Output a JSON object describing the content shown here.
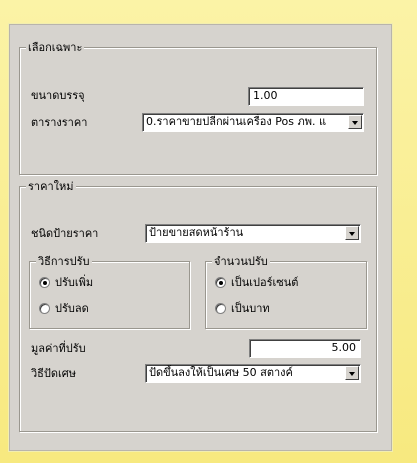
{
  "group_select": {
    "title": "เลือกเฉพาะ",
    "package_size": {
      "label": "ขนาดบรรจุ",
      "value": "1.00"
    },
    "price_table": {
      "label": "ตารางราคา",
      "value": "0.ราคาขายปลีกผ่านเครื่อง Pos ภพ. แ"
    }
  },
  "group_new_price": {
    "title": "ราคาใหม่",
    "price_tag_type": {
      "label": "ชนิดป้ายราคา",
      "value": "ป้ายขายสดหน้าร้าน"
    },
    "adjust_method": {
      "title": "วิธีการปรับ",
      "options": [
        {
          "label": "ปรับเพิ่ม",
          "selected": true
        },
        {
          "label": "ปรับลด",
          "selected": false
        }
      ]
    },
    "adjust_amount": {
      "title": "จำนวนปรับ",
      "options": [
        {
          "label": "เป็นเปอร์เซนต์",
          "selected": true
        },
        {
          "label": "เป็นบาท",
          "selected": false
        }
      ]
    },
    "adjust_value": {
      "label": "มูลค่าที่ปรับ",
      "value": "5.00"
    },
    "rounding_method": {
      "label": "วิธีปัดเศษ",
      "value": "ปัดขึ้นลงให้เป็นเศษ 50 สตางค์"
    }
  },
  "icons": {
    "dropdown": "chevron-down-icon"
  }
}
